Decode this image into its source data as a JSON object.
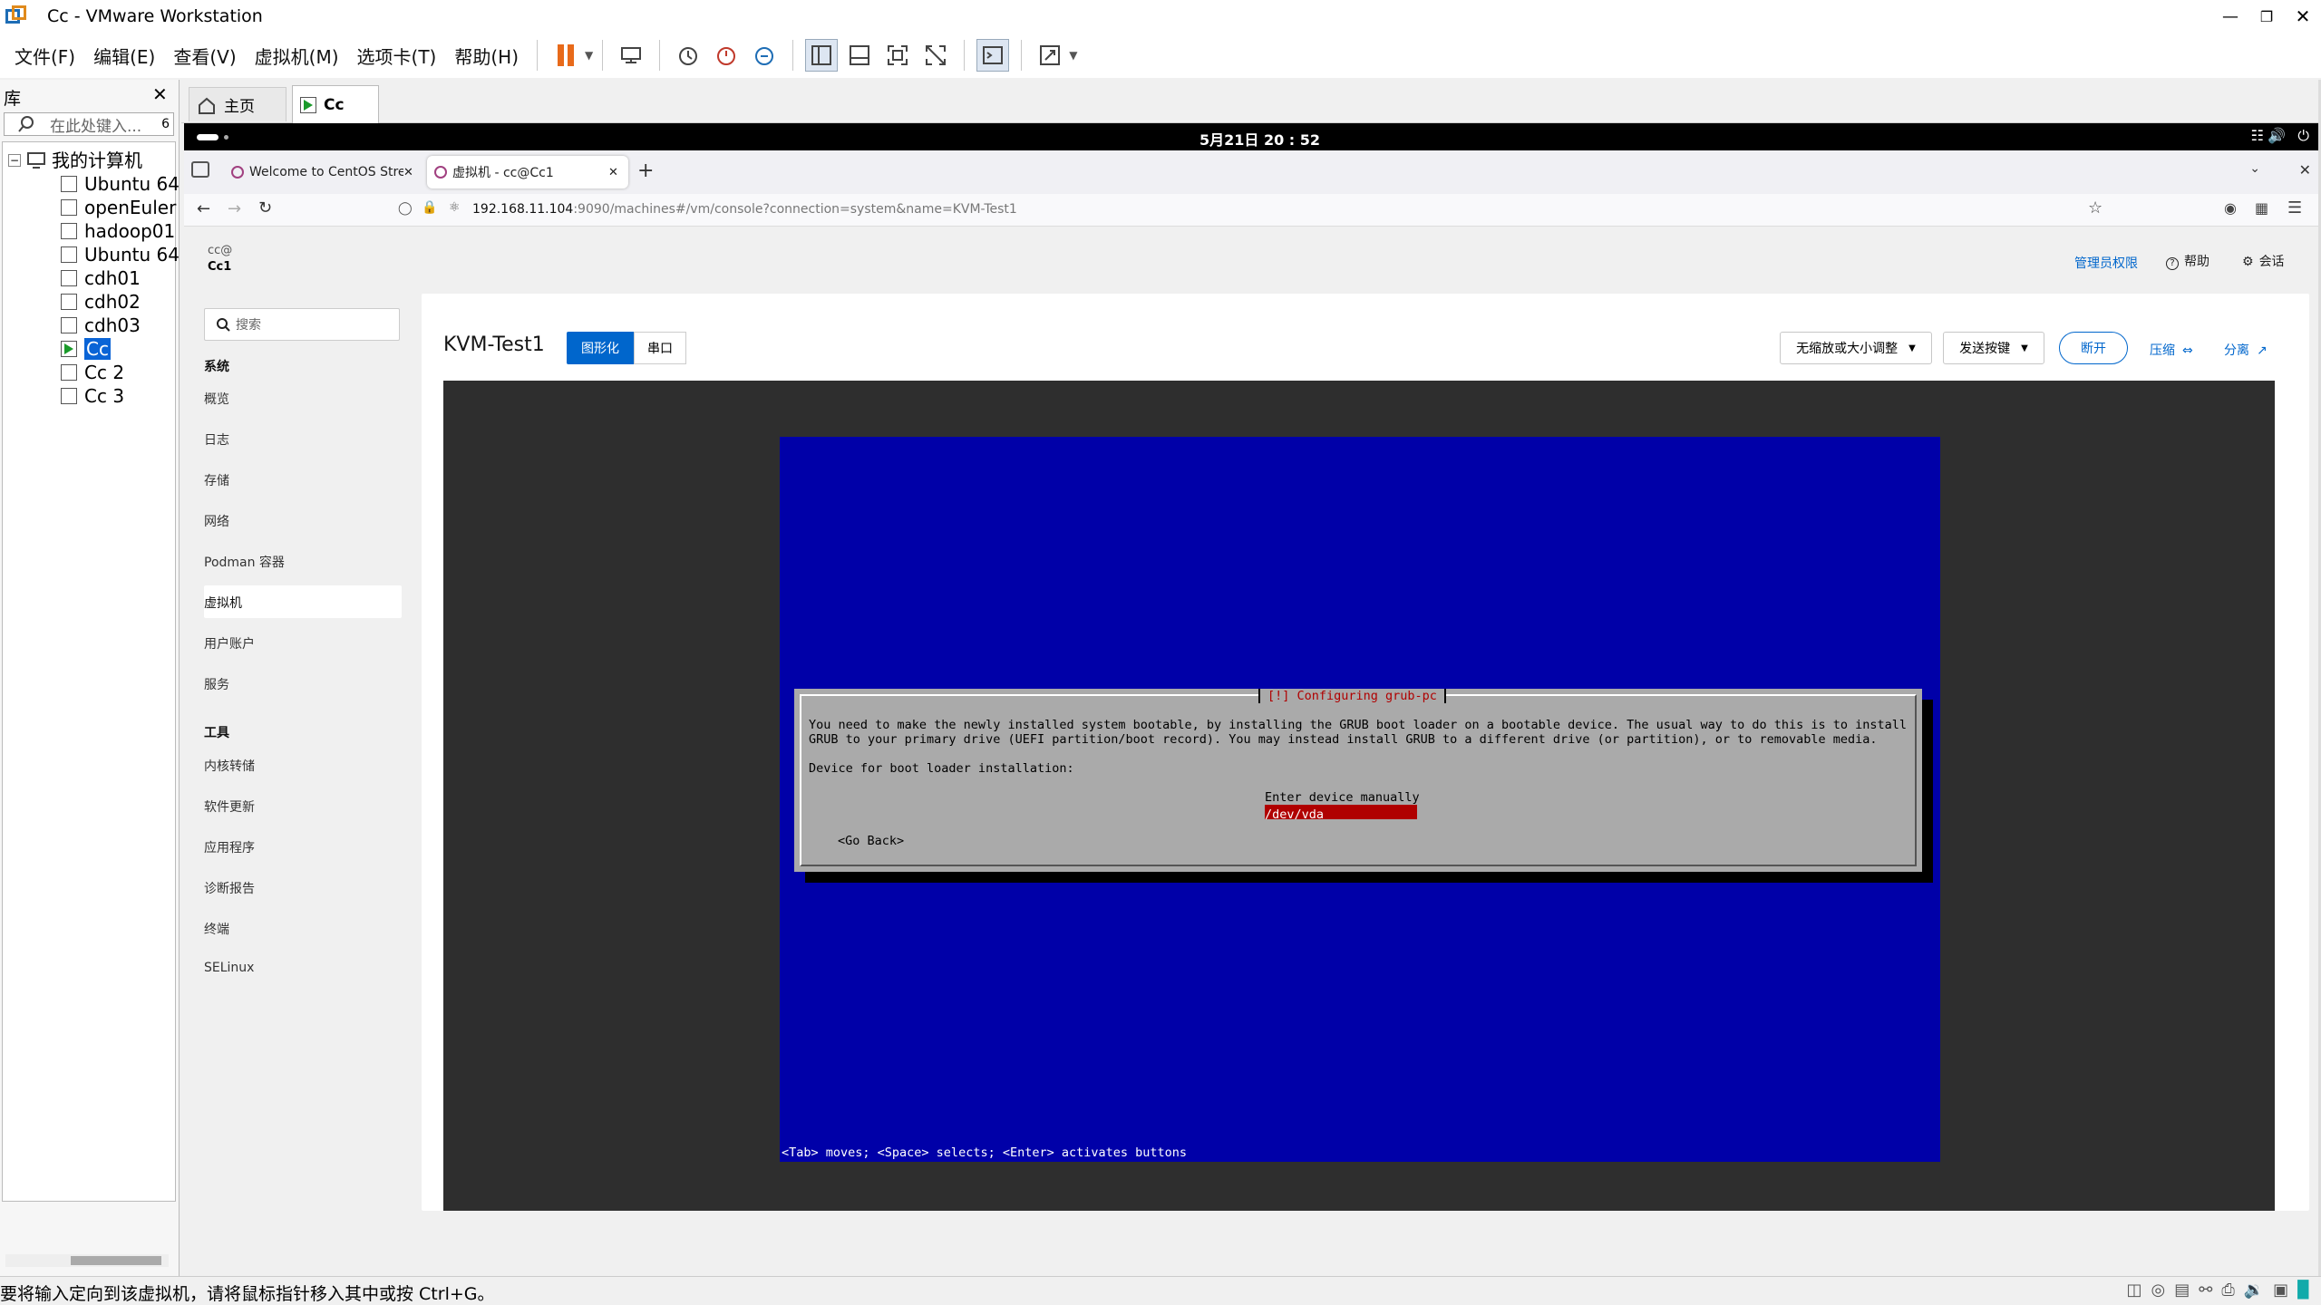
{
  "window": {
    "title": "Cc - VMware Workstation"
  },
  "menu": [
    "文件(F)",
    "编辑(E)",
    "查看(V)",
    "虚拟机(M)",
    "选项卡(T)",
    "帮助(H)"
  ],
  "library": {
    "title": "库",
    "search_placeholder": "在此处键入...",
    "root": "我的计算机",
    "vms": [
      "Ubuntu 64",
      "openEuler",
      "hadoop01",
      "Ubuntu 64",
      "cdh01",
      "cdh02",
      "cdh03",
      "Cc",
      "Cc 2",
      "Cc 3"
    ]
  },
  "vm_tabs": {
    "home": "主页",
    "active": "Cc"
  },
  "guest_topbar": {
    "clock": "5月21日 20 : 52"
  },
  "firefox": {
    "tabs": [
      "Welcome to CentOS Stre",
      "虚拟机 - cc@Cc1"
    ],
    "url_host": "192.168.11.104",
    "url_rest": ":9090/machines#/vm/console?connection=system&name=KVM-Test1"
  },
  "cockpit": {
    "user": "cc@",
    "host": "Cc1",
    "header": {
      "admin": "管理员权限",
      "help": "帮助",
      "session": "会话"
    },
    "search_placeholder": "搜索",
    "section_system": "系统",
    "nav_system": [
      "概览",
      "日志",
      "存储",
      "网络",
      "Podman 容器",
      "虚拟机",
      "用户账户",
      "服务"
    ],
    "section_tools": "工具",
    "nav_tools": [
      "内核转储",
      "软件更新",
      "应用程序",
      "诊断报告",
      "终端",
      "SELinux"
    ],
    "vm_name": "KVM-Test1",
    "view_tabs": [
      "图形化",
      "串口"
    ],
    "scale_dropdown": "无缩放或大小调整",
    "sendkey_dropdown": "发送按键",
    "disconnect": "断开",
    "compress": "压缩",
    "detach": "分离"
  },
  "installer": {
    "dialog_title": "[!] Configuring grub-pc",
    "line1": "You need to make the newly installed system bootable, by installing the GRUB boot loader on a bootable device. The usual way to do this is to install",
    "line2": "GRUB to your primary drive (UEFI partition/boot record). You may instead install GRUB to a different drive (or partition), or to removable media.",
    "line3": "Device for boot loader installation:",
    "option1": "Enter device manually",
    "option2": "/dev/vda",
    "back": "<Go Back>",
    "footer": "<Tab> moves; <Space> selects; <Enter> activates buttons"
  },
  "status": {
    "message": "要将输入定向到该虚拟机，请将鼠标指针移入其中或按 Ctrl+G。"
  },
  "colors": {
    "installer_bg": "#0000a8",
    "dialog_bg": "#aaaaaa",
    "selected": "#b00000",
    "cockpit_blue": "#0066cc"
  }
}
